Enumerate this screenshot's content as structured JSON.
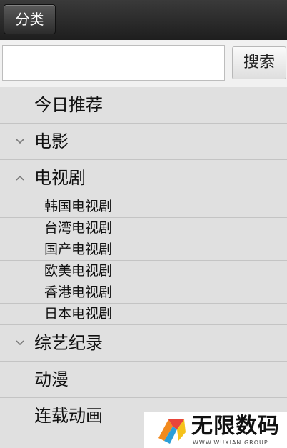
{
  "header": {
    "category_button": "分类"
  },
  "search": {
    "value": "",
    "placeholder": "",
    "button_label": "搜索"
  },
  "menu": {
    "today": "今日推荐",
    "movie": "电影",
    "tv": "电视剧",
    "tv_sub": [
      "韩国电视剧",
      "台湾电视剧",
      "国产电视剧",
      "欧美电视剧",
      "香港电视剧",
      "日本电视剧"
    ],
    "variety": "综艺纪录",
    "anime": "动漫",
    "serial_anime": "连载动画"
  },
  "icons": {
    "collapsed": "chevron-down-icon",
    "expanded": "chevron-up-icon"
  },
  "watermark": {
    "title": "无限数码",
    "subtitle": "WWW.WUXIAN GROUP"
  }
}
